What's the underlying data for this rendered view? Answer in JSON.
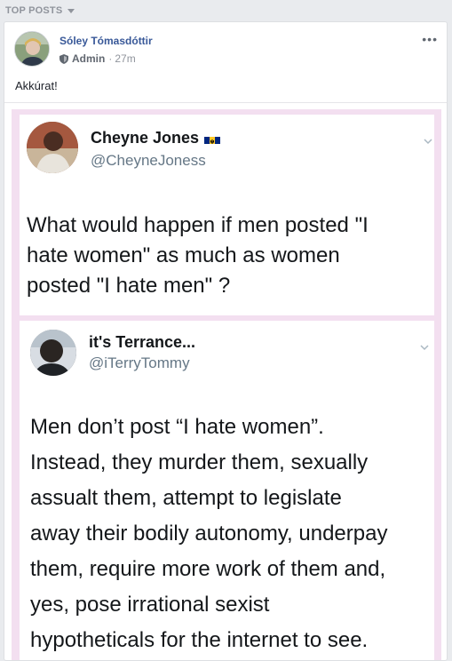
{
  "feed": {
    "section_label": "TOP POSTS",
    "section_icon": "caret-down-icon"
  },
  "post": {
    "author": "Sóley Tómasdóttir",
    "role": "Admin",
    "separator": "·",
    "time": "27m",
    "text": "Akkúrat!",
    "more_icon": "ellipsis-icon",
    "role_icon": "admin-shield-icon",
    "link_color": "#385898"
  },
  "image": {
    "background_color": "#f3dff0",
    "tweets": [
      {
        "name": "Cheyne Jones",
        "handle": "@CheyneJoness",
        "flag_icon": "barbados-flag-icon",
        "body_lines": [
          "What would happen if men posted \"I",
          "hate women\" as much as women",
          "posted \"I hate men\" ?"
        ]
      },
      {
        "name": "it's Terrance...",
        "handle": "@iTerryTommy",
        "body_lines": [
          "Men don’t post “I hate women”.",
          "Instead, they murder them, sexually",
          "assualt them, attempt to legislate",
          "away their bodily autonomy, underpay",
          "them, require more work of them and,",
          "yes, pose irrational sexist",
          "hypotheticals for the internet to see."
        ]
      }
    ]
  }
}
